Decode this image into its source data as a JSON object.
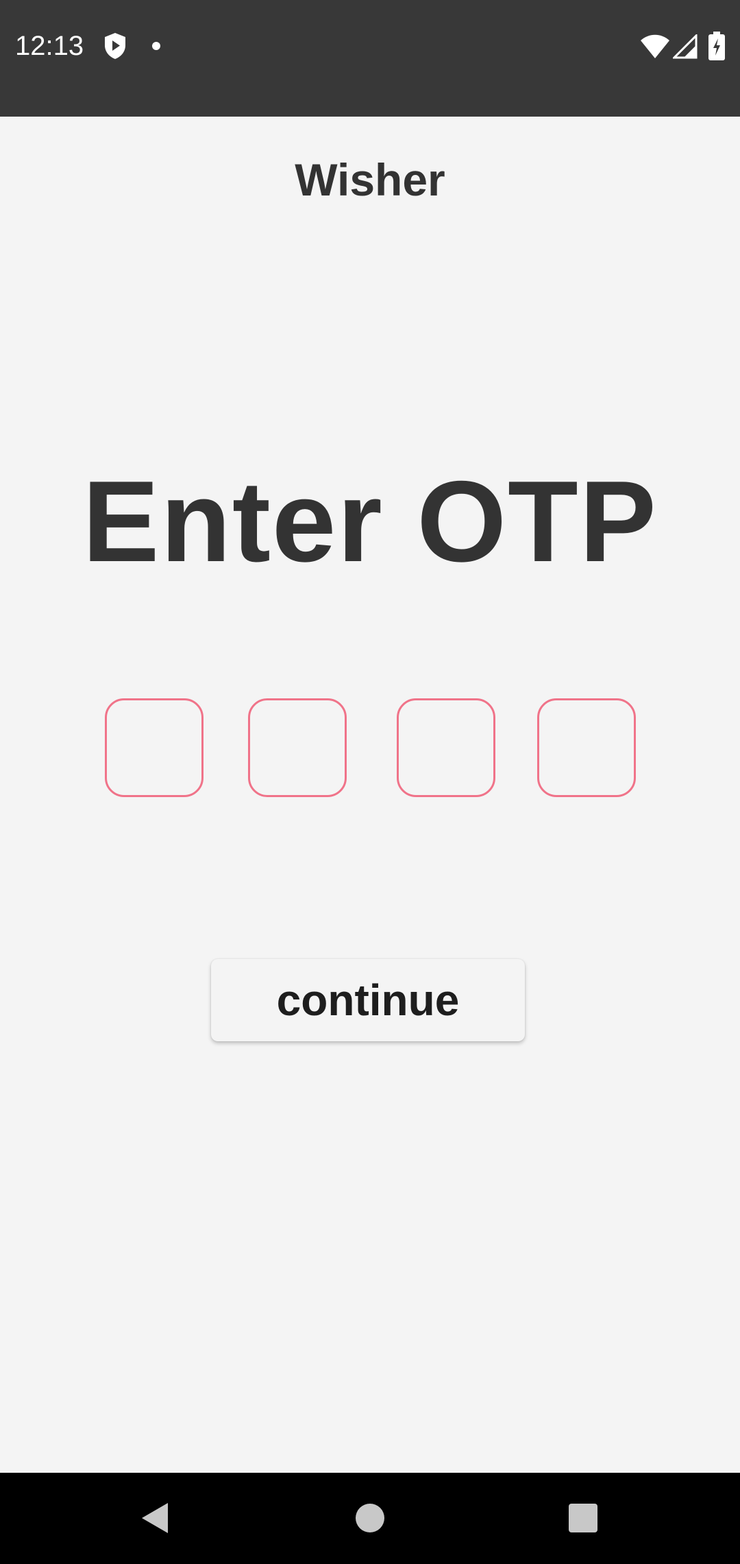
{
  "status_bar": {
    "time": "12:13",
    "icons": [
      "shield-play-icon",
      "notification-dot-icon",
      "wifi-icon",
      "cell-signal-icon",
      "battery-charging-icon"
    ]
  },
  "app": {
    "title": "Wisher"
  },
  "main": {
    "heading": "Enter OTP",
    "otp_digits": [
      "",
      "",
      "",
      ""
    ],
    "continue_label": "continue"
  },
  "navigation": {
    "icons": [
      "back-icon",
      "home-icon",
      "recents-icon"
    ]
  },
  "colors": {
    "status_bar_bg": "#383838",
    "page_bg": "#f4f4f4",
    "text": "#333333",
    "otp_border": "#f07389",
    "nav_bar_bg": "#000000"
  }
}
